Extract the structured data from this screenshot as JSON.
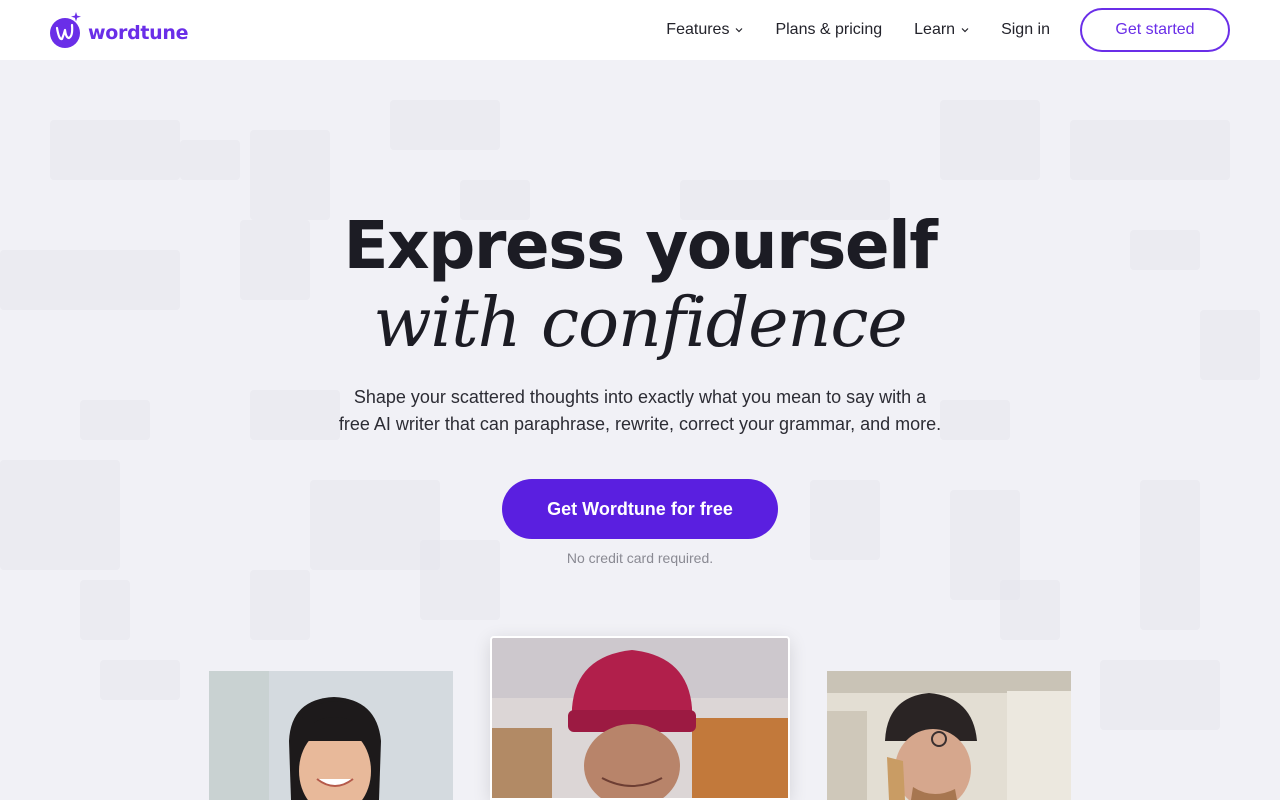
{
  "brand": {
    "name": "wordtune",
    "color": "#6a2ee8"
  },
  "nav": {
    "features": "Features",
    "pricing": "Plans & pricing",
    "learn": "Learn",
    "signin": "Sign in",
    "get_started": "Get started"
  },
  "hero": {
    "line1": "Express yourself",
    "line2": "with confidence",
    "subtitle_line1": "Shape your scattered thoughts into exactly what you mean to say with a",
    "subtitle_line2": "free AI writer that can paraphrase, rewrite, correct your grammar, and more.",
    "cta": "Get Wordtune for free",
    "note": "No credit card required."
  },
  "icons": {
    "logo": "wordtune-logo-icon",
    "chevron": "chevron-down-icon"
  },
  "colors": {
    "accent": "#5a1fe0",
    "background": "#f1f1f6"
  }
}
